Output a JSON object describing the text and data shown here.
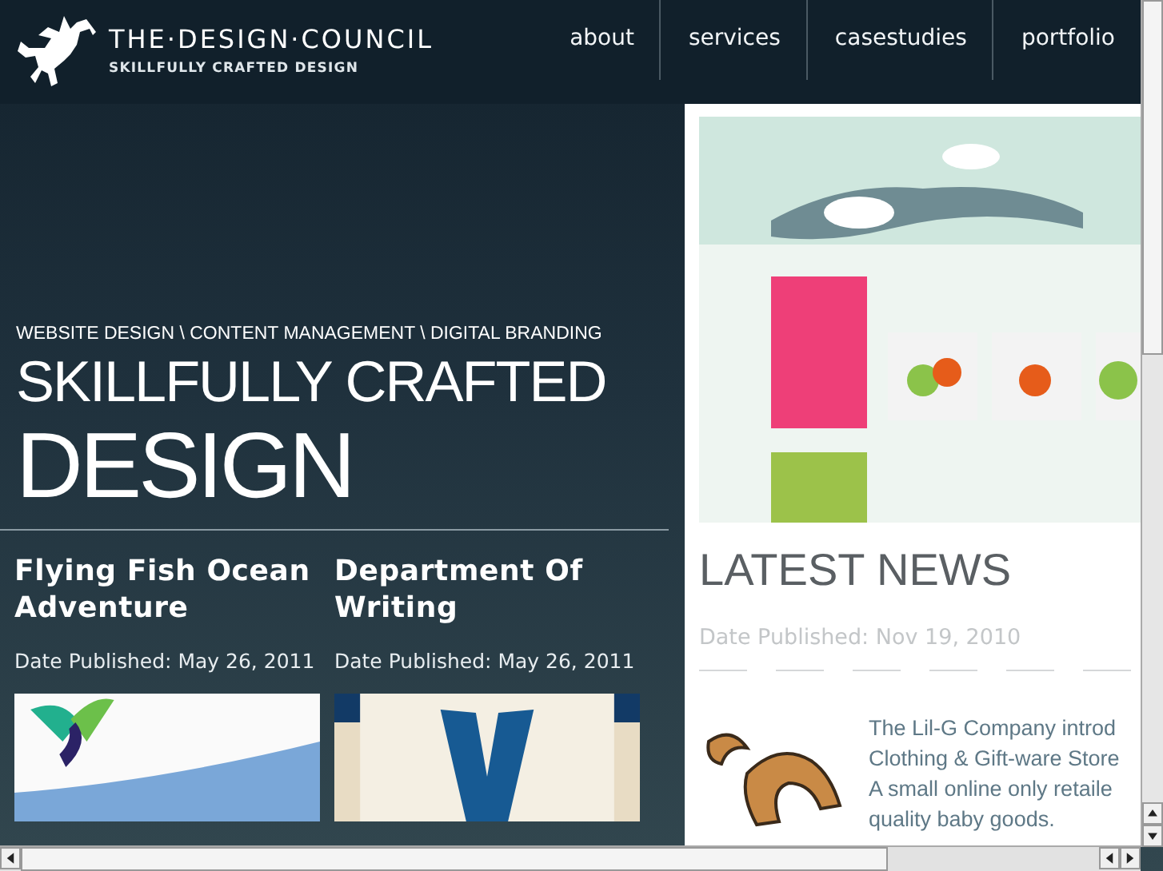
{
  "logo": {
    "name": "THE·DESIGN·COUNCIL",
    "tagline": "SKILLFULLY CRAFTED DESIGN"
  },
  "nav": [
    {
      "label": "about"
    },
    {
      "label": "services"
    },
    {
      "label": "casestudies"
    },
    {
      "label": "portfolio"
    }
  ],
  "hero": {
    "services": "WEBSITE DESIGN  \\ CONTENT MANAGEMENT \\ DIGITAL BRANDING",
    "headline": "SKILLFULLY CRAFTED",
    "headline_big": "DESIGN"
  },
  "projects": [
    {
      "title": "Flying Fish Ocean Adventure",
      "date": "Date Published: May 26, 2011",
      "kind": "fish"
    },
    {
      "title": "Department Of Writing",
      "date": "Date Published: May 26, 2011",
      "kind": "pen"
    }
  ],
  "news": {
    "heading": "LATEST NEWS",
    "date": "Date Published: Nov 19, 2010",
    "text_lines": [
      "The Lil-G Company introd",
      "Clothing & Gift-ware Store",
      "A small online only retaile",
      "quality baby goods."
    ]
  }
}
